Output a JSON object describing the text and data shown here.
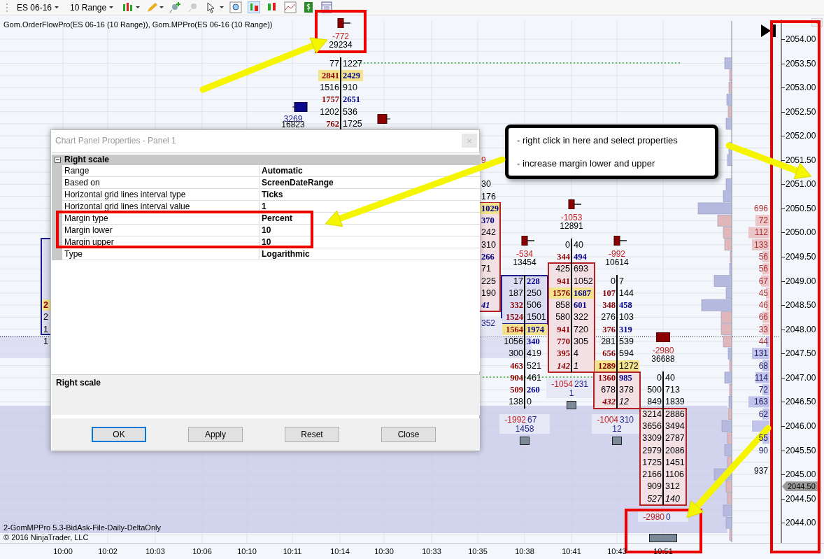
{
  "toolbar": {
    "instrument": "ES 06-16",
    "period": "10 Range"
  },
  "chart": {
    "indicator_label": "Gom.OrderFlowPro(ES 06-16 (10 Range)), Gom.MPPro(ES 06-16 (10 Range))",
    "bars": [
      {
        "delta": "-772",
        "volume": "29234",
        "marker": {
          "kind": "small"
        },
        "cells": [
          {
            "bid": "77",
            "ask": "1227",
            "bid_bold": false,
            "ask_bold": false,
            "poc": false,
            "italic": false
          },
          {
            "bid": "2841",
            "ask": "2429",
            "bid_bold": true,
            "ask_bold": true,
            "poc": true,
            "italic": false
          },
          {
            "bid": "1516",
            "ask": "910",
            "bid_bold": false,
            "ask_bold": false,
            "poc": false,
            "italic": false
          },
          {
            "bid": "1757",
            "ask": "2651",
            "bid_bold": true,
            "ask_bold": true,
            "poc": false,
            "italic": false
          },
          {
            "bid": "1202",
            "ask": "536",
            "bid_bold": false,
            "ask_bold": false,
            "poc": false,
            "italic": false
          },
          {
            "bid": "762",
            "ask": "1725",
            "bid_bold": true,
            "ask_bold": false,
            "poc": false,
            "italic": false
          }
        ]
      },
      {
        "delta": "-534",
        "volume": "13454",
        "marker": {
          "kind": "small"
        },
        "box": {
          "kind": "buy"
        },
        "end_delta": "-1992",
        "end_ask": "67",
        "end_volume": "1458",
        "cells": [
          {
            "bid": "17",
            "ask": "228",
            "bid_bold": false,
            "ask_bold": true,
            "poc": false,
            "italic": false,
            "in_box": true
          },
          {
            "bid": "187",
            "ask": "250",
            "bid_bold": false,
            "ask_bold": false,
            "poc": false,
            "italic": false,
            "in_box": true
          },
          {
            "bid": "332",
            "ask": "506",
            "bid_bold": true,
            "ask_bold": false,
            "poc": false,
            "italic": false,
            "in_box": true
          },
          {
            "bid": "1524",
            "ask": "1501",
            "bid_bold": true,
            "ask_bold": false,
            "poc": false,
            "italic": false,
            "in_box": true
          },
          {
            "bid": "1564",
            "ask": "1974",
            "bid_bold": true,
            "ask_bold": true,
            "poc": true,
            "italic": false,
            "in_box": false
          },
          {
            "bid": "1056",
            "ask": "340",
            "bid_bold": false,
            "ask_bold": true,
            "poc": false,
            "italic": false,
            "in_box": false
          },
          {
            "bid": "300",
            "ask": "419",
            "bid_bold": false,
            "ask_bold": false,
            "poc": false,
            "italic": false,
            "in_box": false
          },
          {
            "bid": "463",
            "ask": "521",
            "bid_bold": true,
            "ask_bold": false,
            "poc": false,
            "italic": false,
            "in_box": false
          },
          {
            "bid": "904",
            "ask": "461",
            "bid_bold": true,
            "ask_bold": false,
            "poc": false,
            "italic": false,
            "in_box": false
          },
          {
            "bid": "509",
            "ask": "260",
            "bid_bold": true,
            "ask_bold": true,
            "poc": false,
            "italic": false,
            "in_box": false
          },
          {
            "bid": "138",
            "ask": "0",
            "bid_bold": false,
            "ask_bold": false,
            "poc": false,
            "italic": false,
            "in_box": false
          }
        ]
      },
      {
        "delta": "-1053",
        "volume": "12891",
        "marker": {
          "kind": "small"
        },
        "box": {
          "kind": "sell"
        },
        "end_delta": "-1054",
        "end_ask": "231",
        "end_volume": "1",
        "cells": [
          {
            "bid": "0",
            "ask": "40",
            "bid_bold": false,
            "ask_bold": false,
            "poc": false,
            "italic": false,
            "in_box": false
          },
          {
            "bid": "344",
            "ask": "494",
            "bid_bold": true,
            "ask_bold": true,
            "poc": false,
            "italic": false,
            "in_box": false
          },
          {
            "bid": "425",
            "ask": "693",
            "bid_bold": false,
            "ask_bold": false,
            "poc": false,
            "italic": false,
            "in_box": true
          },
          {
            "bid": "941",
            "ask": "1052",
            "bid_bold": true,
            "ask_bold": false,
            "poc": false,
            "italic": false,
            "in_box": true
          },
          {
            "bid": "1576",
            "ask": "1687",
            "bid_bold": true,
            "ask_bold": true,
            "poc": true,
            "italic": false,
            "in_box": true
          },
          {
            "bid": "858",
            "ask": "601",
            "bid_bold": false,
            "ask_bold": true,
            "poc": false,
            "italic": false,
            "in_box": true
          },
          {
            "bid": "580",
            "ask": "322",
            "bid_bold": false,
            "ask_bold": false,
            "poc": false,
            "italic": false,
            "in_box": true
          },
          {
            "bid": "941",
            "ask": "720",
            "bid_bold": true,
            "ask_bold": false,
            "poc": false,
            "italic": false,
            "in_box": true
          },
          {
            "bid": "770",
            "ask": "305",
            "bid_bold": true,
            "ask_bold": false,
            "poc": false,
            "italic": false,
            "in_box": true
          },
          {
            "bid": "395",
            "ask": "4",
            "bid_bold": true,
            "ask_bold": false,
            "poc": false,
            "italic": false,
            "in_box": true
          },
          {
            "bid": "142",
            "ask": "1",
            "bid_bold": true,
            "ask_bold": false,
            "poc": false,
            "italic": true,
            "in_box": true
          }
        ]
      },
      {
        "delta": "-992",
        "volume": "10614",
        "marker": {
          "kind": "small"
        },
        "box": {
          "kind": "sell"
        },
        "end_delta": "-1004",
        "end_ask": "310",
        "end_volume": "12",
        "cells": [
          {
            "bid": "0",
            "ask": "7",
            "bid_bold": false,
            "ask_bold": false,
            "poc": false,
            "italic": false,
            "in_box": false
          },
          {
            "bid": "107",
            "ask": "144",
            "bid_bold": true,
            "ask_bold": false,
            "poc": false,
            "italic": false,
            "in_box": false
          },
          {
            "bid": "348",
            "ask": "458",
            "bid_bold": true,
            "ask_bold": true,
            "poc": false,
            "italic": false,
            "in_box": false
          },
          {
            "bid": "276",
            "ask": "103",
            "bid_bold": false,
            "ask_bold": false,
            "poc": false,
            "italic": false,
            "in_box": false
          },
          {
            "bid": "376",
            "ask": "319",
            "bid_bold": true,
            "ask_bold": true,
            "poc": false,
            "italic": false,
            "in_box": false
          },
          {
            "bid": "281",
            "ask": "539",
            "bid_bold": false,
            "ask_bold": false,
            "poc": false,
            "italic": false,
            "in_box": false
          },
          {
            "bid": "656",
            "ask": "594",
            "bid_bold": true,
            "ask_bold": false,
            "poc": false,
            "italic": false,
            "in_box": false
          },
          {
            "bid": "1289",
            "ask": "1272",
            "bid_bold": true,
            "ask_bold": false,
            "poc": true,
            "italic": false,
            "in_box": false
          },
          {
            "bid": "1360",
            "ask": "985",
            "bid_bold": true,
            "ask_bold": true,
            "poc": false,
            "italic": false,
            "in_box": true
          },
          {
            "bid": "678",
            "ask": "378",
            "bid_bold": false,
            "ask_bold": false,
            "poc": false,
            "italic": false,
            "in_box": true
          },
          {
            "bid": "432",
            "ask": "12",
            "bid_bold": true,
            "ask_bold": false,
            "poc": false,
            "italic": true,
            "in_box": true
          }
        ]
      },
      {
        "delta": "-2980",
        "volume": "36688",
        "marker": {
          "kind": "large"
        },
        "box": {
          "kind": "sell"
        },
        "end_delta": "-2980",
        "end_ask": "0",
        "cells": [
          {
            "bid": "0",
            "ask": "40",
            "bid_bold": false,
            "ask_bold": false,
            "poc": false,
            "italic": false,
            "in_box": false
          },
          {
            "bid": "500",
            "ask": "713",
            "bid_bold": false,
            "ask_bold": false,
            "poc": false,
            "italic": false,
            "in_box": false
          },
          {
            "bid": "849",
            "ask": "1839",
            "bid_bold": false,
            "ask_bold": false,
            "poc": false,
            "italic": false,
            "in_box": false
          },
          {
            "bid": "3214",
            "ask": "2886",
            "bid_bold": false,
            "ask_bold": false,
            "poc": false,
            "italic": false,
            "in_box": true
          },
          {
            "bid": "3656",
            "ask": "3494",
            "bid_bold": false,
            "ask_bold": false,
            "poc": false,
            "italic": false,
            "in_box": true
          },
          {
            "bid": "3309",
            "ask": "2787",
            "bid_bold": false,
            "ask_bold": false,
            "poc": false,
            "italic": false,
            "in_box": true
          },
          {
            "bid": "2979",
            "ask": "2086",
            "bid_bold": false,
            "ask_bold": false,
            "poc": false,
            "italic": false,
            "in_box": true
          },
          {
            "bid": "1725",
            "ask": "1451",
            "bid_bold": false,
            "ask_bold": false,
            "poc": false,
            "italic": false,
            "in_box": true
          },
          {
            "bid": "2166",
            "ask": "1106",
            "bid_bold": false,
            "ask_bold": false,
            "poc": false,
            "italic": false,
            "in_box": true
          },
          {
            "bid": "909",
            "ask": "312",
            "bid_bold": false,
            "ask_bold": false,
            "poc": false,
            "italic": false,
            "in_box": true
          },
          {
            "bid": "527",
            "ask": "140",
            "bid_bold": false,
            "ask_bold": false,
            "poc": false,
            "italic": true,
            "in_box": true
          }
        ]
      }
    ],
    "side_summary": {
      "delta": "3269",
      "volume": "16823"
    },
    "clipped_right": {
      "delta": "9",
      "end": "352",
      "cells": [
        {
          "ask": "30",
          "bold": false,
          "poc": false,
          "italic": false
        },
        {
          "ask": "176",
          "bold": false,
          "poc": false,
          "italic": false
        },
        {
          "ask": "1029",
          "bold": true,
          "poc": true,
          "italic": false
        },
        {
          "ask": "370",
          "bold": true,
          "poc": false,
          "italic": false
        },
        {
          "ask": "242",
          "bold": false,
          "poc": false,
          "italic": false
        },
        {
          "ask": "310",
          "bold": false,
          "poc": false,
          "italic": false
        },
        {
          "ask": "266",
          "bold": true,
          "poc": false,
          "italic": false
        },
        {
          "ask": "71",
          "bold": false,
          "poc": false,
          "italic": false
        },
        {
          "ask": "225",
          "bold": false,
          "poc": false,
          "italic": false
        },
        {
          "ask": "190",
          "bold": false,
          "poc": false,
          "italic": false
        },
        {
          "ask": "41",
          "bold": true,
          "poc": false,
          "italic": true
        }
      ]
    },
    "clipped_left": [
      {
        "text": "2",
        "poc": true
      },
      {
        "text": "2",
        "poc": false
      },
      {
        "text": "1",
        "poc": false
      },
      {
        "text": "1",
        "poc": false
      }
    ],
    "profile_numbers": [
      "696",
      "72",
      "112",
      "133",
      "56",
      "56",
      "67",
      "45",
      "46",
      "66",
      "33",
      "44",
      "131",
      "68",
      "114",
      "72",
      "163",
      "62",
      "55",
      "90",
      "937"
    ],
    "price_axis": [
      "2054.00",
      "2053.50",
      "2053.00",
      "2052.50",
      "2052.00",
      "2051.50",
      "2051.00",
      "2050.50",
      "2050.00",
      "2049.50",
      "2049.00",
      "2048.50",
      "2048.00",
      "2047.50",
      "2047.00",
      "2046.50",
      "2046.00",
      "2045.50",
      "2045.00",
      "2044.50",
      "2044.00"
    ],
    "current_price": "2044.50",
    "time_axis": [
      "10:00",
      "10:02",
      "10:03",
      "10:06",
      "10:10",
      "10:11",
      "10:14",
      "10:30",
      "10:33",
      "10:35",
      "10:38",
      "10:41",
      "10:43",
      "10:51"
    ],
    "footer": [
      "2-GomMPPro 5.3-BidAsk-File-Daily-DeltaOnly",
      "© 2016 NinjaTrader, LLC"
    ]
  },
  "dialog": {
    "title": "Chart Panel Properties - Panel 1",
    "close": "×",
    "category": "Right scale",
    "category_expanded": true,
    "rows": [
      {
        "name": "Range",
        "value": "Automatic"
      },
      {
        "name": "Based on",
        "value": "ScreenDateRange"
      },
      {
        "name": "Horizontal grid lines interval type",
        "value": "Ticks"
      },
      {
        "name": "Horizontal grid lines interval value",
        "value": "1"
      },
      {
        "name": "Margin type",
        "value": "Percent"
      },
      {
        "name": "Margin lower",
        "value": "10"
      },
      {
        "name": "Margin upper",
        "value": "10"
      },
      {
        "name": "Type",
        "value": "Logarithmic"
      }
    ],
    "description": "Right scale",
    "buttons": [
      {
        "label": "OK",
        "focused": true
      },
      {
        "label": "Apply",
        "focused": false
      },
      {
        "label": "Reset",
        "focused": false
      },
      {
        "label": "Close",
        "focused": false
      }
    ]
  },
  "callout": [
    "- right click in here and select properties",
    "- increase margin lower and upper"
  ]
}
